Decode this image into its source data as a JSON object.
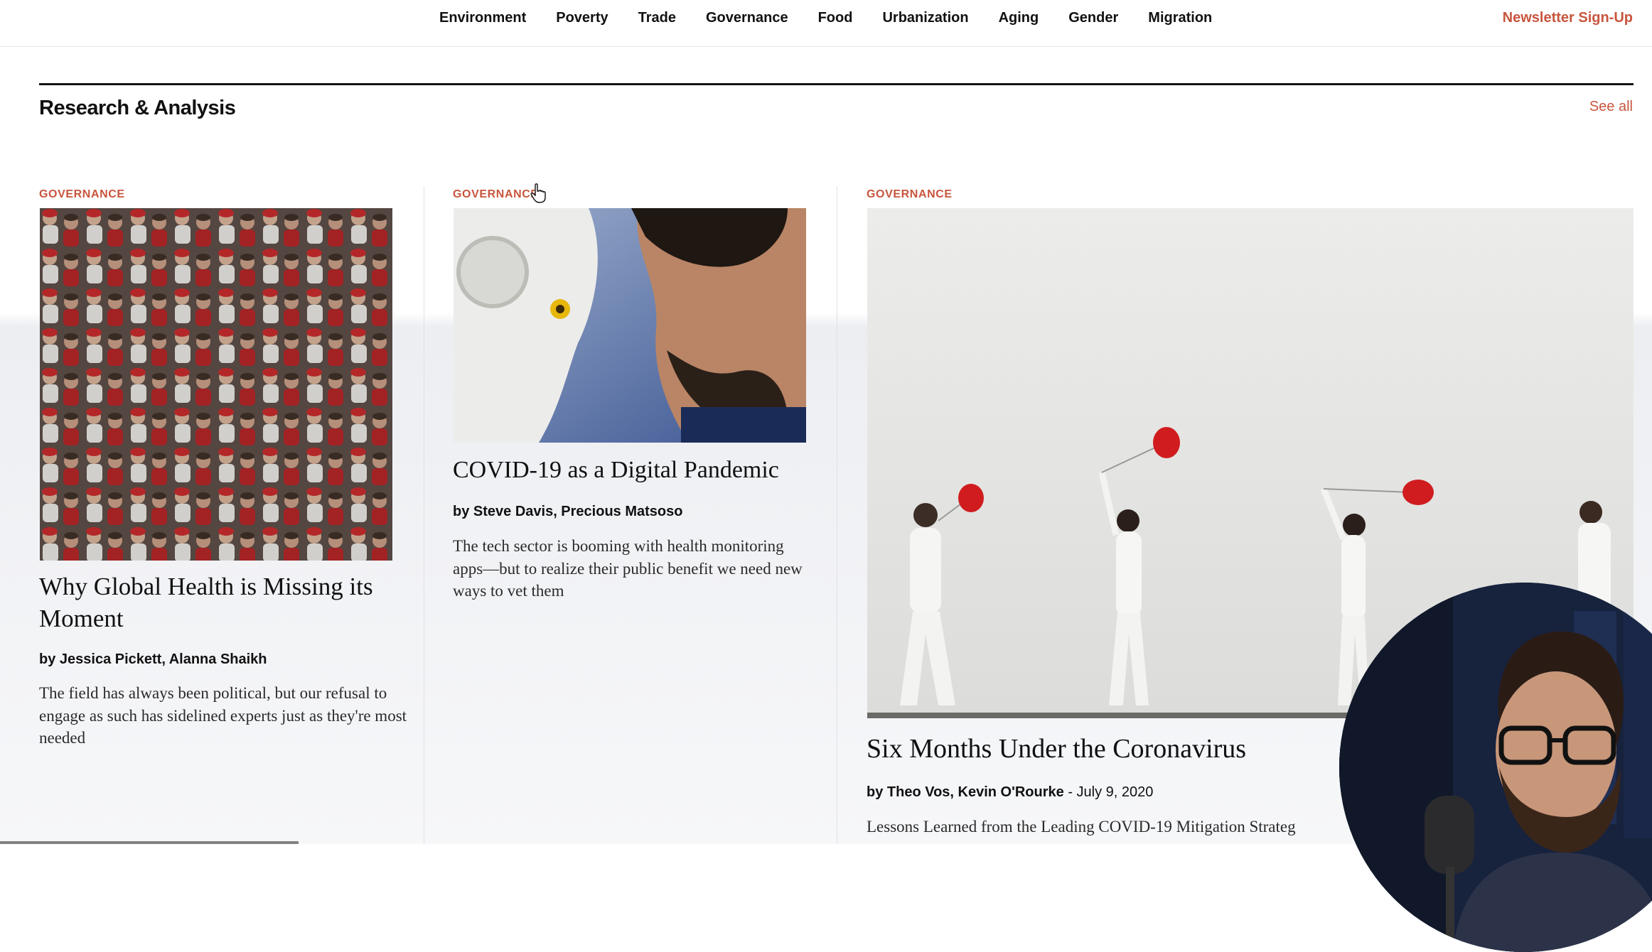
{
  "nav": {
    "links": [
      "Environment",
      "Poverty",
      "Trade",
      "Governance",
      "Food",
      "Urbanization",
      "Aging",
      "Gender",
      "Migration"
    ],
    "newsletter": "Newsletter Sign-Up"
  },
  "section": {
    "title": "Research & Analysis",
    "see_all": "See all"
  },
  "articles": [
    {
      "category": "GOVERNANCE",
      "title": "Why Global Health is Missing its Moment",
      "authors": "by Jessica Pickett, Alanna Shaikh",
      "date": "",
      "deck": "The field has always been political, but our refusal to engage as such has sidelined experts just as they're most needed",
      "image": "crowd-red-caps-photo"
    },
    {
      "category": "GOVERNANCE",
      "title": "COVID-19 as a Digital Pandemic",
      "authors": "by Steve Davis, Precious Matsoso",
      "date": "",
      "deck": "The tech sector is booming with health monitoring apps—but to realize their public benefit we need new ways to vet them",
      "image": "robot-and-man-photo"
    },
    {
      "category": "GOVERNANCE",
      "title": "Six Months Under the Coronavirus",
      "authors": "by Theo Vos, Kevin O'Rourke",
      "date": " - July 9, 2020",
      "deck": "Lessons Learned from the Leading COVID-19 Mitigation Strateg",
      "image": "masked-people-red-balloons-photo"
    }
  ],
  "colors": {
    "accent": "#c8553d",
    "text": "#111111",
    "rule": "#151515"
  }
}
